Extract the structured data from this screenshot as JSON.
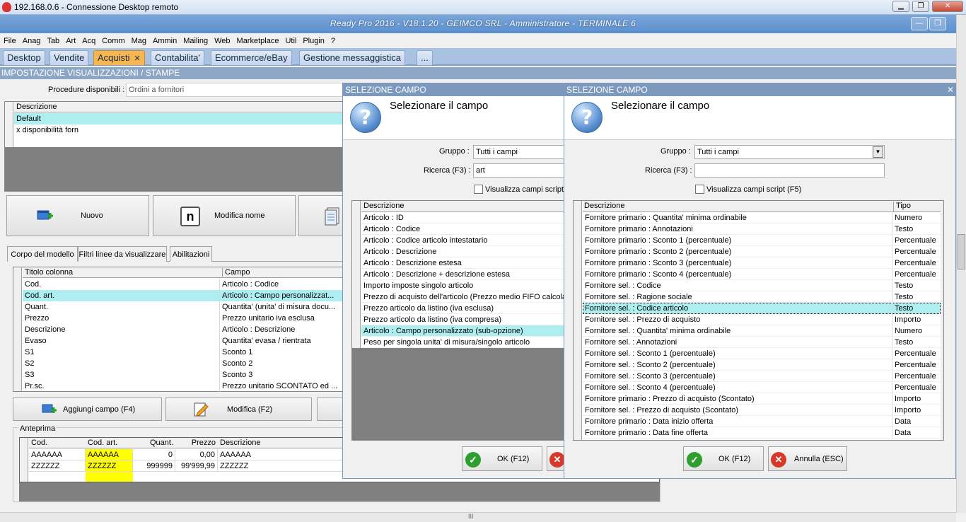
{
  "rdp": {
    "title": "192.168.0.6 - Connessione Desktop remoto"
  },
  "app": {
    "title": "Ready Pro 2016 - V18.1.20 - GEIMCO SRL - Amministratore - TERMINALE 6"
  },
  "menu": [
    "File",
    "Anag",
    "Tab",
    "Art",
    "Acq",
    "Comm",
    "Mag",
    "Ammin",
    "Mailing",
    "Web",
    "Marketplace",
    "Util",
    "Plugin",
    "?"
  ],
  "tabs": [
    {
      "label": "Desktop"
    },
    {
      "label": "Vendite"
    },
    {
      "label": "Acquisti",
      "close": "✕"
    },
    {
      "label": "Contabilita'"
    },
    {
      "label": "Ecommerce/eBay"
    },
    {
      "label": "Gestione messaggistica"
    },
    {
      "label": "..."
    }
  ],
  "section_title": "IMPOSTAZIONE VISUALIZZAZIONI / STAMPE",
  "procedure": {
    "label": "Procedure disponibili :",
    "value": "Ordini a fornitori"
  },
  "layouts": {
    "header": "Descrizione",
    "rows": [
      "Default",
      "x disponibilità forn"
    ]
  },
  "buttons": {
    "nuovo": "Nuovo",
    "modifica_nome": "Modifica nome",
    "aggiungi": "Aggiungi campo (F4)",
    "modifica": "Modifica (F2)"
  },
  "subtabs": [
    "Corpo del modello",
    "Filtri linee da visualizzare",
    "Abilitazioni"
  ],
  "columns_grid": {
    "headers": [
      "Titolo colonna",
      "Campo"
    ],
    "rows": [
      [
        "Cod.",
        "Articolo : Codice"
      ],
      [
        "Cod. art.",
        "Articolo : Campo personalizzat..."
      ],
      [
        "Quant.",
        "Quantita' (unita' di misura docu..."
      ],
      [
        "Prezzo",
        "Prezzo unitario iva esclusa"
      ],
      [
        "Descrizione",
        "Articolo : Descrizione"
      ],
      [
        "Evaso",
        "Quantita' evasa / rientrata"
      ],
      [
        "S1",
        "Sconto 1"
      ],
      [
        "S2",
        "Sconto 2"
      ],
      [
        "S3",
        "Sconto 3"
      ],
      [
        "Pr.sc.",
        "Prezzo unitario SCONTATO ed ..."
      ]
    ]
  },
  "preview": {
    "label": "Anteprima",
    "headers": [
      "Cod.",
      "Cod. art.",
      "Quant.",
      "Prezzo",
      "Descrizione"
    ],
    "rows": [
      [
        "AAAAAA",
        "AAAAAA",
        "0",
        "0,00",
        "AAAAAA"
      ],
      [
        "ZZZZZZ",
        "ZZZZZZ",
        "999999",
        "99'999,99",
        "ZZZZZZ"
      ]
    ]
  },
  "dialog1": {
    "title": "SELEZIONE CAMPO",
    "heading": "Selezionare il campo",
    "gruppo_label": "Gruppo :",
    "gruppo_value": "Tutti i campi",
    "ricerca_label": "Ricerca (F3) :",
    "ricerca_value": "art",
    "script_label": "Visualizza campi script (F",
    "grid_header": "Descrizione",
    "rows": [
      "Articolo : ID",
      "Articolo : Codice",
      "Articolo : Codice articolo intestatario",
      "Articolo : Descrizione",
      "Articolo : Descrizione estesa",
      "Articolo : Descrizione + descrizione estesa",
      "Importo imposte singolo articolo",
      "Prezzo di acquisto dell'articolo (Prezzo medio FIFO calcolato",
      "Prezzo articolo da listino (iva esclusa)",
      "Prezzo articolo da listino (iva compresa)",
      "Articolo : Campo personalizzato (sub-opzione)",
      "Peso per singola unita' di misura/singolo articolo"
    ],
    "selected": 10,
    "ok": "OK (F12)"
  },
  "dialog2": {
    "title": "SELEZIONE CAMPO",
    "heading": "Selezionare il campo",
    "gruppo_label": "Gruppo :",
    "gruppo_value": "Tutti i campi",
    "ricerca_label": "Ricerca (F3) :",
    "ricerca_value": "",
    "script_label": "Visualizza campi script (F5)",
    "grid_headers": [
      "Descrizione",
      "Tipo"
    ],
    "rows": [
      [
        "Fornitore primario : Quantita' minima ordinabile",
        "Numero"
      ],
      [
        "Fornitore primario : Annotazioni",
        "Testo"
      ],
      [
        "Fornitore primario : Sconto 1 (percentuale)",
        "Percentuale"
      ],
      [
        "Fornitore primario : Sconto 2 (percentuale)",
        "Percentuale"
      ],
      [
        "Fornitore primario : Sconto 3 (percentuale)",
        "Percentuale"
      ],
      [
        "Fornitore primario : Sconto 4 (percentuale)",
        "Percentuale"
      ],
      [
        "Fornitore sel. : Codice",
        "Testo"
      ],
      [
        "Fornitore sel. : Ragione sociale",
        "Testo"
      ],
      [
        "Fornitore sel. : Codice articolo",
        "Testo"
      ],
      [
        "Fornitore sel. : Prezzo di acquisto",
        "Importo"
      ],
      [
        "Fornitore sel. : Quantita' minima ordinabile",
        "Numero"
      ],
      [
        "Fornitore sel. : Annotazioni",
        "Testo"
      ],
      [
        "Fornitore sel. : Sconto 1 (percentuale)",
        "Percentuale"
      ],
      [
        "Fornitore sel. : Sconto 2 (percentuale)",
        "Percentuale"
      ],
      [
        "Fornitore sel. : Sconto 3 (percentuale)",
        "Percentuale"
      ],
      [
        "Fornitore sel. : Sconto 4 (percentuale)",
        "Percentuale"
      ],
      [
        "Fornitore primario : Prezzo di acquisto (Scontato)",
        "Importo"
      ],
      [
        "Fornitore sel. : Prezzo di acquisto (Scontato)",
        "Importo"
      ],
      [
        "Fornitore primario : Data inizio offerta",
        "Data"
      ],
      [
        "Fornitore primario : Data fine offerta",
        "Data"
      ]
    ],
    "selected": 8,
    "ok": "OK (F12)",
    "cancel": "Annulla (ESC)"
  },
  "statusbar": {
    "grip": "III"
  },
  "colors": {
    "selection": "#aeeef0",
    "tab_active": "#f6b752",
    "title_bar": "#5a8fcf",
    "highlight_yellow": "#ffff00"
  }
}
